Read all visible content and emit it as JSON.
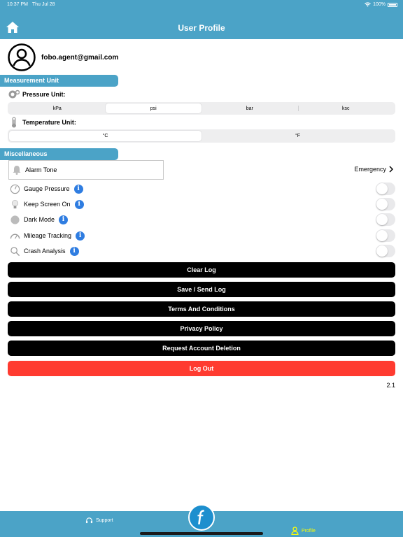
{
  "status_bar": {
    "time": "10:37 PM",
    "date": "Thu Jul 28",
    "battery": "100%"
  },
  "header": {
    "title": "User Profile",
    "home_icon": "home-icon"
  },
  "profile": {
    "email": "fobo.agent@gmail.com",
    "avatar_icon": "user-avatar-icon"
  },
  "measurement": {
    "section_title": "Measurement Unit",
    "pressure_label": "Pressure Unit:",
    "pressure_options": [
      "kPa",
      "psi",
      "bar",
      "ksc"
    ],
    "pressure_selected": "psi",
    "temperature_label": "Temperature Unit:",
    "temperature_options": [
      "°C",
      "°F"
    ],
    "temperature_selected": "°C"
  },
  "misc": {
    "section_title": "Miscellaneous",
    "alarm_label": "Alarm Tone",
    "alarm_value": "Emergency",
    "toggles": [
      {
        "label": "Gauge Pressure",
        "on": false
      },
      {
        "label": "Keep Screen On",
        "on": false
      },
      {
        "label": "Dark Mode",
        "on": false
      },
      {
        "label": "Mileage Tracking",
        "on": false
      },
      {
        "label": "Crash Analysis",
        "on": false
      }
    ]
  },
  "actions": {
    "clear_log": "Clear Log",
    "save_send_log": "Save / Send Log",
    "terms": "Terms And Conditions",
    "privacy": "Privacy Policy",
    "delete_account": "Request Account Deletion",
    "logout": "Log Out"
  },
  "version": "2.1",
  "tab_bar": {
    "support": "Support",
    "profile": "Profile",
    "active_tab": "Profile"
  },
  "colors": {
    "accent": "#4ba3c7",
    "button": "#000000",
    "logout": "#ff3b30",
    "active_tab": "#ffff00",
    "info": "#2f7de1"
  }
}
